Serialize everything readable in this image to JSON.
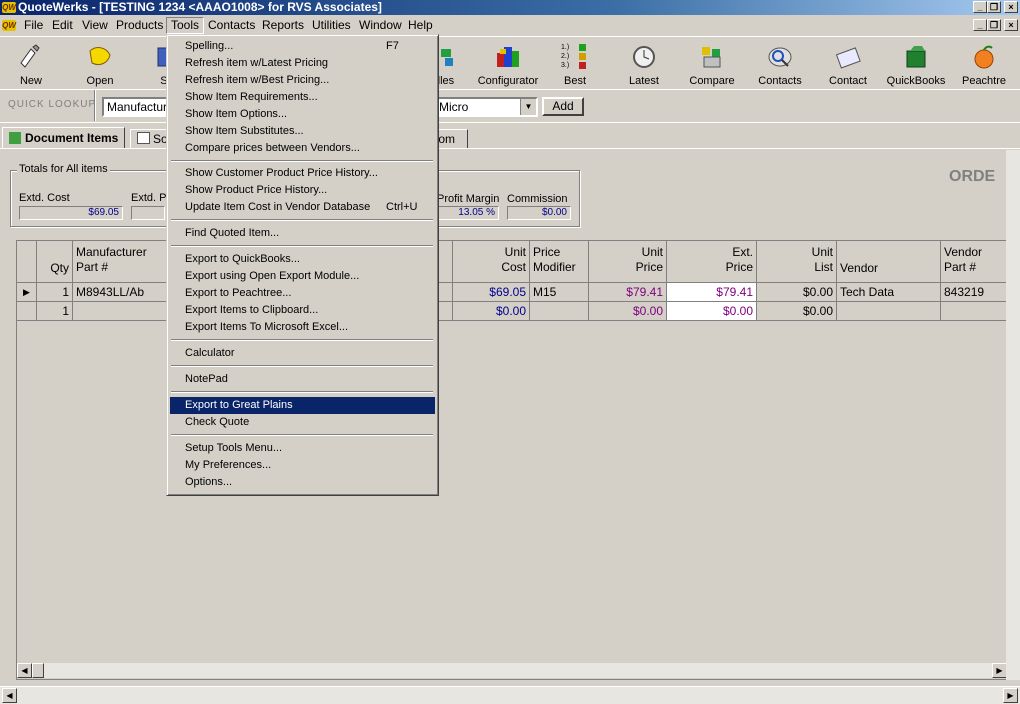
{
  "window": {
    "title": "QuoteWerks - [TESTING 1234 <AAAO1008> for RVS Associates]",
    "logo_text": "QW"
  },
  "menubar": [
    "File",
    "Edit",
    "View",
    "Products",
    "Tools",
    "Contacts",
    "Reports",
    "Utilities",
    "Window",
    "Help"
  ],
  "toolbar": [
    {
      "label": "New",
      "icon": "new-document-icon"
    },
    {
      "label": "Open",
      "icon": "open-folder-icon"
    },
    {
      "label": "Sa",
      "icon": "save-icon"
    },
    {
      "label": "ndles",
      "icon": "bundles-icon"
    },
    {
      "label": "Configurator",
      "icon": "configurator-icon"
    },
    {
      "label": "Best",
      "icon": "best-list-icon"
    },
    {
      "label": "Latest",
      "icon": "clock-icon"
    },
    {
      "label": "Compare",
      "icon": "compare-icon"
    },
    {
      "label": "Contacts",
      "icon": "contacts-icon"
    },
    {
      "label": "Contact",
      "icon": "contact-card-icon"
    },
    {
      "label": "QuickBooks",
      "icon": "quickbooks-icon"
    },
    {
      "label": "Peachtre",
      "icon": "peach-icon"
    }
  ],
  "best_list_digits": [
    "1.)",
    "2.)",
    "3.)"
  ],
  "quick_lookup": {
    "label": "QUICK LOOKUP",
    "field1": "Manufacture",
    "field2": "Micro",
    "add_label": "Add"
  },
  "tabs": {
    "document_items": "Document Items",
    "so": "So",
    "tom": "tom"
  },
  "order_label": "ORDE",
  "totals": {
    "group_label": "Totals for All items",
    "extd_cost_label": "Extd. Cost",
    "extd_cost": "$69.05",
    "extd_p_label": "Extd. P",
    "profit_margin_label": "Profit Margin",
    "profit_margin": "13.05 %",
    "commission_label": "Commission",
    "commission": "$0.00"
  },
  "grid": {
    "headers": {
      "qty": "Qty",
      "mfr1": "Manufacturer",
      "mfr2": "Part #",
      "unitcost1": "Unit",
      "unitcost2": "Cost",
      "pricemod1": "Price",
      "pricemod2": "Modifier",
      "unitprice1": "Unit",
      "unitprice2": "Price",
      "extprice1": "Ext.",
      "extprice2": "Price",
      "unitlist1": "Unit",
      "unitlist2": "List",
      "vendor": "Vendor",
      "vpart1": "Vendor",
      "vpart2": "Part #"
    },
    "rows": [
      {
        "qty": "1",
        "mfr": "M8943LL/Ab",
        "unit_cost": "$69.05",
        "price_mod": "M15",
        "unit_price": "$79.41",
        "ext_price": "$79.41",
        "unit_list": "$0.00",
        "vendor": "Tech Data",
        "vendor_part": "843219"
      },
      {
        "qty": "1",
        "mfr": "",
        "unit_cost": "$0.00",
        "price_mod": "",
        "unit_price": "$0.00",
        "ext_price": "$0.00",
        "unit_list": "$0.00",
        "vendor": "",
        "vendor_part": ""
      }
    ]
  },
  "tools_menu": {
    "items": [
      {
        "label": "Spelling...",
        "shortcut": "F7"
      },
      {
        "label": "Refresh item w/Latest Pricing"
      },
      {
        "label": "Refresh item w/Best Pricing..."
      },
      {
        "label": "Show Item Requirements..."
      },
      {
        "label": "Show Item Options..."
      },
      {
        "label": "Show Item Substitutes..."
      },
      {
        "label": "Compare prices between Vendors..."
      },
      {
        "label": "Show Customer Product Price History..."
      },
      {
        "label": "Show Product Price History..."
      },
      {
        "label": "Update Item Cost in Vendor Database",
        "shortcut": "Ctrl+U"
      },
      {
        "label": "Find Quoted Item..."
      },
      {
        "label": "Export to QuickBooks..."
      },
      {
        "label": "Export using Open Export Module..."
      },
      {
        "label": "Export to Peachtree..."
      },
      {
        "label": "Export Items to Clipboard..."
      },
      {
        "label": "Export Items To Microsoft Excel..."
      },
      {
        "label": "Calculator"
      },
      {
        "label": "NotePad"
      },
      {
        "label": "Export to Great Plains",
        "highlighted": true
      },
      {
        "label": "Check Quote"
      },
      {
        "label": "Setup Tools Menu..."
      },
      {
        "label": "My Preferences..."
      },
      {
        "label": "Options..."
      }
    ]
  },
  "colors": {
    "titlebar": "#0a246a",
    "highlight": "#0a246a",
    "cost_blue": "#00008b",
    "price_purple": "#800080"
  }
}
